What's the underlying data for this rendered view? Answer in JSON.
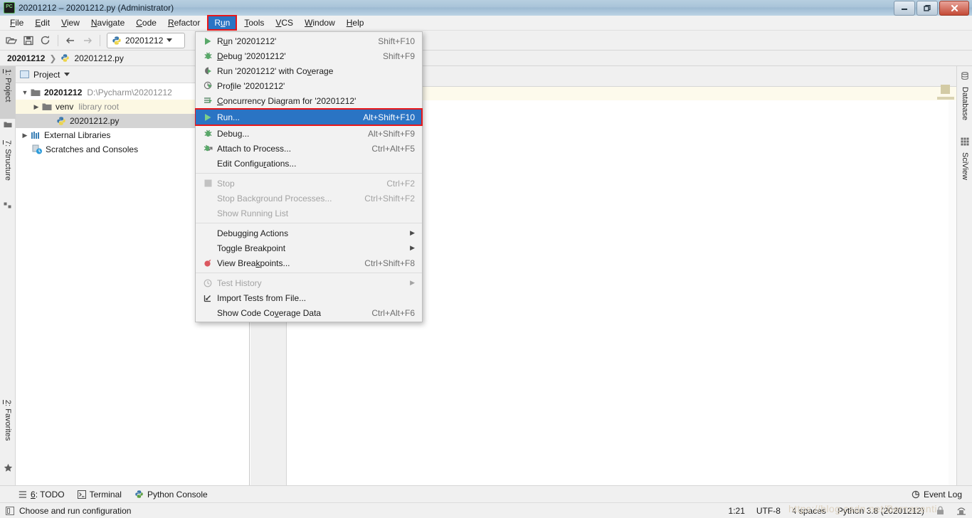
{
  "window": {
    "title": "20201212 – 20201212.py (Administrator)",
    "app_icon": "pycharm-icon",
    "controls": {
      "minimize": "–",
      "restore": "❐",
      "close": "✕"
    }
  },
  "menubar": {
    "items": [
      {
        "label": "File",
        "mnemonic": "F",
        "active": false
      },
      {
        "label": "Edit",
        "mnemonic": "E",
        "active": false
      },
      {
        "label": "View",
        "mnemonic": "V",
        "active": false
      },
      {
        "label": "Navigate",
        "mnemonic": "N",
        "active": false
      },
      {
        "label": "Code",
        "mnemonic": "C",
        "active": false
      },
      {
        "label": "Refactor",
        "mnemonic": "R",
        "active": false
      },
      {
        "label": "Run",
        "mnemonic": "u",
        "active": true
      },
      {
        "label": "Tools",
        "mnemonic": "T",
        "active": false
      },
      {
        "label": "VCS",
        "mnemonic": "V",
        "active": false
      },
      {
        "label": "Window",
        "mnemonic": "W",
        "active": false
      },
      {
        "label": "Help",
        "mnemonic": "H",
        "active": false
      }
    ],
    "highlight_color": "#e8171a",
    "selected_color": "#2a74c4"
  },
  "toolbar": {
    "open_icon": "open-folder-icon",
    "save_icon": "save-icon",
    "sync_icon": "sync-icon",
    "back_icon": "arrow-left-icon",
    "forward_icon": "arrow-right-icon",
    "run_config": {
      "icon": "python-file-icon",
      "label": "20201212",
      "caret": "▾"
    }
  },
  "breadcrumb": {
    "project": "20201212",
    "separator": "❯",
    "file": "20201212.py",
    "file_icon": "python-file-icon"
  },
  "left_rail": {
    "tabs": [
      {
        "label": "1: Project",
        "mnemonic": "1",
        "icon": "folder-icon",
        "selected": true
      },
      {
        "label": "7: Structure",
        "mnemonic": "7",
        "icon": "structure-icon",
        "selected": false
      },
      {
        "label": "2: Favorites",
        "mnemonic": "2",
        "icon": "star-icon",
        "selected": false
      }
    ]
  },
  "right_rail": {
    "tabs": [
      {
        "label": "Database",
        "icon": "database-icon"
      },
      {
        "label": "SciView",
        "icon": "grid-icon"
      }
    ]
  },
  "project_panel": {
    "title": "Project",
    "title_icon": "project-icon",
    "title_caret": "▾",
    "locate_icon": "locate-target-icon",
    "tree": [
      {
        "label": "20201212",
        "note": "D:\\Pycharm\\20201212",
        "icon": "folder-icon",
        "arrow": "▾",
        "depth": 0,
        "bold": true,
        "highlight": "none"
      },
      {
        "label": "venv",
        "note": "library root",
        "icon": "folder-icon",
        "arrow": "▸",
        "depth": 1,
        "bold": false,
        "highlight": "yellow"
      },
      {
        "label": "20201212.py",
        "note": "",
        "icon": "python-file-icon",
        "arrow": "",
        "depth": 2,
        "bold": false,
        "highlight": "gray"
      },
      {
        "label": "External Libraries",
        "note": "",
        "icon": "libraries-icon",
        "arrow": "▸",
        "depth": 0,
        "bold": false,
        "highlight": "none"
      },
      {
        "label": "Scratches and Consoles",
        "note": "",
        "icon": "scratches-icon",
        "arrow": "",
        "depth": 0,
        "bold": false,
        "highlight": "none"
      }
    ]
  },
  "run_menu": {
    "groups": [
      {
        "items": [
          {
            "label": "Run '20201212'",
            "mnemonic": "u",
            "shortcut": "Shift+F10",
            "icon": "run-green-triangle-icon",
            "state": "normal",
            "submenu": false
          },
          {
            "label": "Debug '20201212'",
            "mnemonic": "D",
            "shortcut": "Shift+F9",
            "icon": "debug-bug-icon",
            "state": "normal",
            "submenu": false
          },
          {
            "label": "Run '20201212' with Coverage",
            "mnemonic": "v",
            "shortcut": "",
            "icon": "coverage-icon",
            "state": "normal",
            "submenu": false
          },
          {
            "label": "Profile '20201212'",
            "mnemonic": "f",
            "shortcut": "",
            "icon": "profile-clock-icon",
            "state": "normal",
            "submenu": false
          },
          {
            "label": "Concurrency Diagram for '20201212'",
            "mnemonic": "C",
            "shortcut": "",
            "icon": "concurrency-diagram-icon",
            "state": "normal",
            "submenu": false
          },
          {
            "label": "Run...",
            "mnemonic": "",
            "shortcut": "Alt+Shift+F10",
            "icon": "run-green-triangle-icon",
            "state": "selected",
            "submenu": false
          },
          {
            "label": "Debug...",
            "mnemonic": "",
            "shortcut": "Alt+Shift+F9",
            "icon": "debug-bug-icon",
            "state": "normal",
            "submenu": false
          },
          {
            "label": "Attach to Process...",
            "mnemonic": "",
            "shortcut": "Ctrl+Alt+F5",
            "icon": "attach-process-icon",
            "state": "normal",
            "submenu": false
          },
          {
            "label": "Edit Configurations...",
            "mnemonic": "r",
            "shortcut": "",
            "icon": "",
            "state": "normal",
            "submenu": false
          }
        ]
      },
      {
        "items": [
          {
            "label": "Stop",
            "mnemonic": "",
            "shortcut": "Ctrl+F2",
            "icon": "stop-square-icon",
            "state": "disabled",
            "submenu": false
          },
          {
            "label": "Stop Background Processes...",
            "mnemonic": "",
            "shortcut": "Ctrl+Shift+F2",
            "icon": "",
            "state": "disabled",
            "submenu": false
          },
          {
            "label": "Show Running List",
            "mnemonic": "",
            "shortcut": "",
            "icon": "",
            "state": "disabled",
            "submenu": false
          }
        ]
      },
      {
        "items": [
          {
            "label": "Debugging Actions",
            "mnemonic": "",
            "shortcut": "",
            "icon": "",
            "state": "normal",
            "submenu": true
          },
          {
            "label": "Toggle Breakpoint",
            "mnemonic": "",
            "shortcut": "",
            "icon": "",
            "state": "normal",
            "submenu": true
          },
          {
            "label": "View Breakpoints...",
            "mnemonic": "k",
            "shortcut": "Ctrl+Shift+F8",
            "icon": "breakpoint-dot-icon",
            "state": "normal",
            "submenu": false
          }
        ]
      },
      {
        "items": [
          {
            "label": "Test History",
            "mnemonic": "",
            "shortcut": "",
            "icon": "history-clock-icon",
            "state": "disabled",
            "submenu": true
          },
          {
            "label": "Import Tests from File...",
            "mnemonic": "",
            "shortcut": "",
            "icon": "import-tests-icon",
            "state": "normal",
            "submenu": false
          },
          {
            "label": "Show Code Coverage Data",
            "mnemonic": "v",
            "shortcut": "Ctrl+Alt+F6",
            "icon": "",
            "state": "normal",
            "submenu": false
          }
        ]
      }
    ]
  },
  "bottom_bar": {
    "items": [
      {
        "label": "6: TODO",
        "mnemonic": "6",
        "icon": "todo-list-icon"
      },
      {
        "label": "Terminal",
        "mnemonic": "",
        "icon": "terminal-icon"
      },
      {
        "label": "Python Console",
        "mnemonic": "",
        "icon": "python-console-icon"
      }
    ],
    "event_log": {
      "label": "Event Log",
      "icon": "event-log-icon"
    }
  },
  "status_bar": {
    "message": "Choose and run configuration",
    "message_icon": "widget-icon",
    "caret_position": "1:21",
    "encoding": "UTF-8",
    "indent": "4 spaces",
    "interpreter": "Python 3.8 (20201212)",
    "lock_icon": "lock-icon",
    "inspection_icon": "hector-inspection-icon"
  },
  "watermark": "https://blog.csdn.net/Bernasenti"
}
